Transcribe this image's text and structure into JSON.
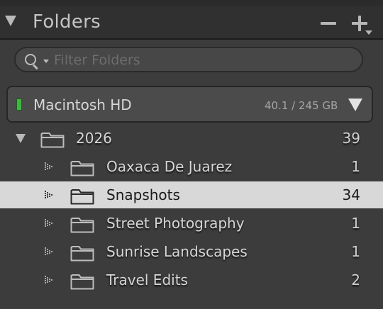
{
  "header": {
    "title": "Folders",
    "remove_icon": "minus-icon",
    "add_icon": "plus-menu-icon"
  },
  "search": {
    "placeholder": "Filter Folders",
    "value": "",
    "icon": "magnifier-dropdown-icon"
  },
  "volume": {
    "name": "Macintosh HD",
    "usage": "40.1 / 245 GB",
    "status_color": "#3fb83f"
  },
  "tree": {
    "root": {
      "label": "2026",
      "count": "39"
    },
    "children": [
      {
        "label": "Oaxaca De Juarez",
        "count": "1"
      },
      {
        "label": "Snapshots",
        "count": "34"
      },
      {
        "label": "Street Photography",
        "count": "1"
      },
      {
        "label": "Sunrise Landscapes",
        "count": "1"
      },
      {
        "label": "Travel Edits",
        "count": "2"
      }
    ],
    "selected_index": 1
  },
  "colors": {
    "panel_bg": "#3c3c3c",
    "header_bg": "#303030",
    "selected_row_bg": "#d8d8d8",
    "text": "#d6d6d6"
  }
}
